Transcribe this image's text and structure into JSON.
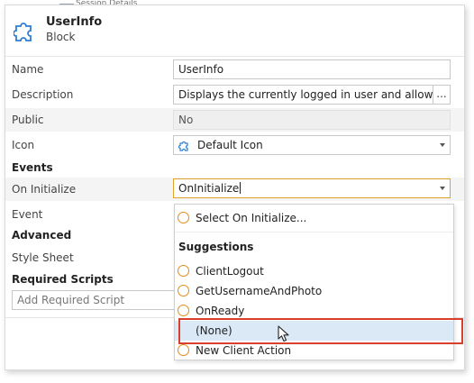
{
  "header": {
    "title": "UserInfo",
    "subtitle": "Block",
    "top_partial": "Session Details"
  },
  "props": {
    "name": {
      "label": "Name",
      "value": "UserInfo"
    },
    "description": {
      "label": "Description",
      "value": "Displays the currently logged in user and allows to l",
      "more": "..."
    },
    "public": {
      "label": "Public",
      "value": "No"
    },
    "icon": {
      "label": "Icon",
      "value": "Default Icon"
    }
  },
  "sections": {
    "events": "Events",
    "advanced": "Advanced",
    "required_scripts": "Required Scripts"
  },
  "events": {
    "on_initialize": {
      "label": "On Initialize",
      "value": "OnInitialize"
    },
    "event": {
      "label": "Event"
    }
  },
  "advanced": {
    "style_sheet": {
      "label": "Style Sheet"
    }
  },
  "required_scripts": {
    "placeholder": "Add Required Script"
  },
  "dropdown": {
    "select_label": "Select On Initialize...",
    "suggestions_label": "Suggestions",
    "options": [
      "ClientLogout",
      "GetUsernameAndPhoto",
      "OnReady",
      "(None)",
      "New Client Action"
    ]
  },
  "colors": {
    "highlight": "#d7402d",
    "option_circle": "#e28d1c",
    "selected_bg": "#dbe9f7",
    "active_border": "#e1a22a"
  }
}
